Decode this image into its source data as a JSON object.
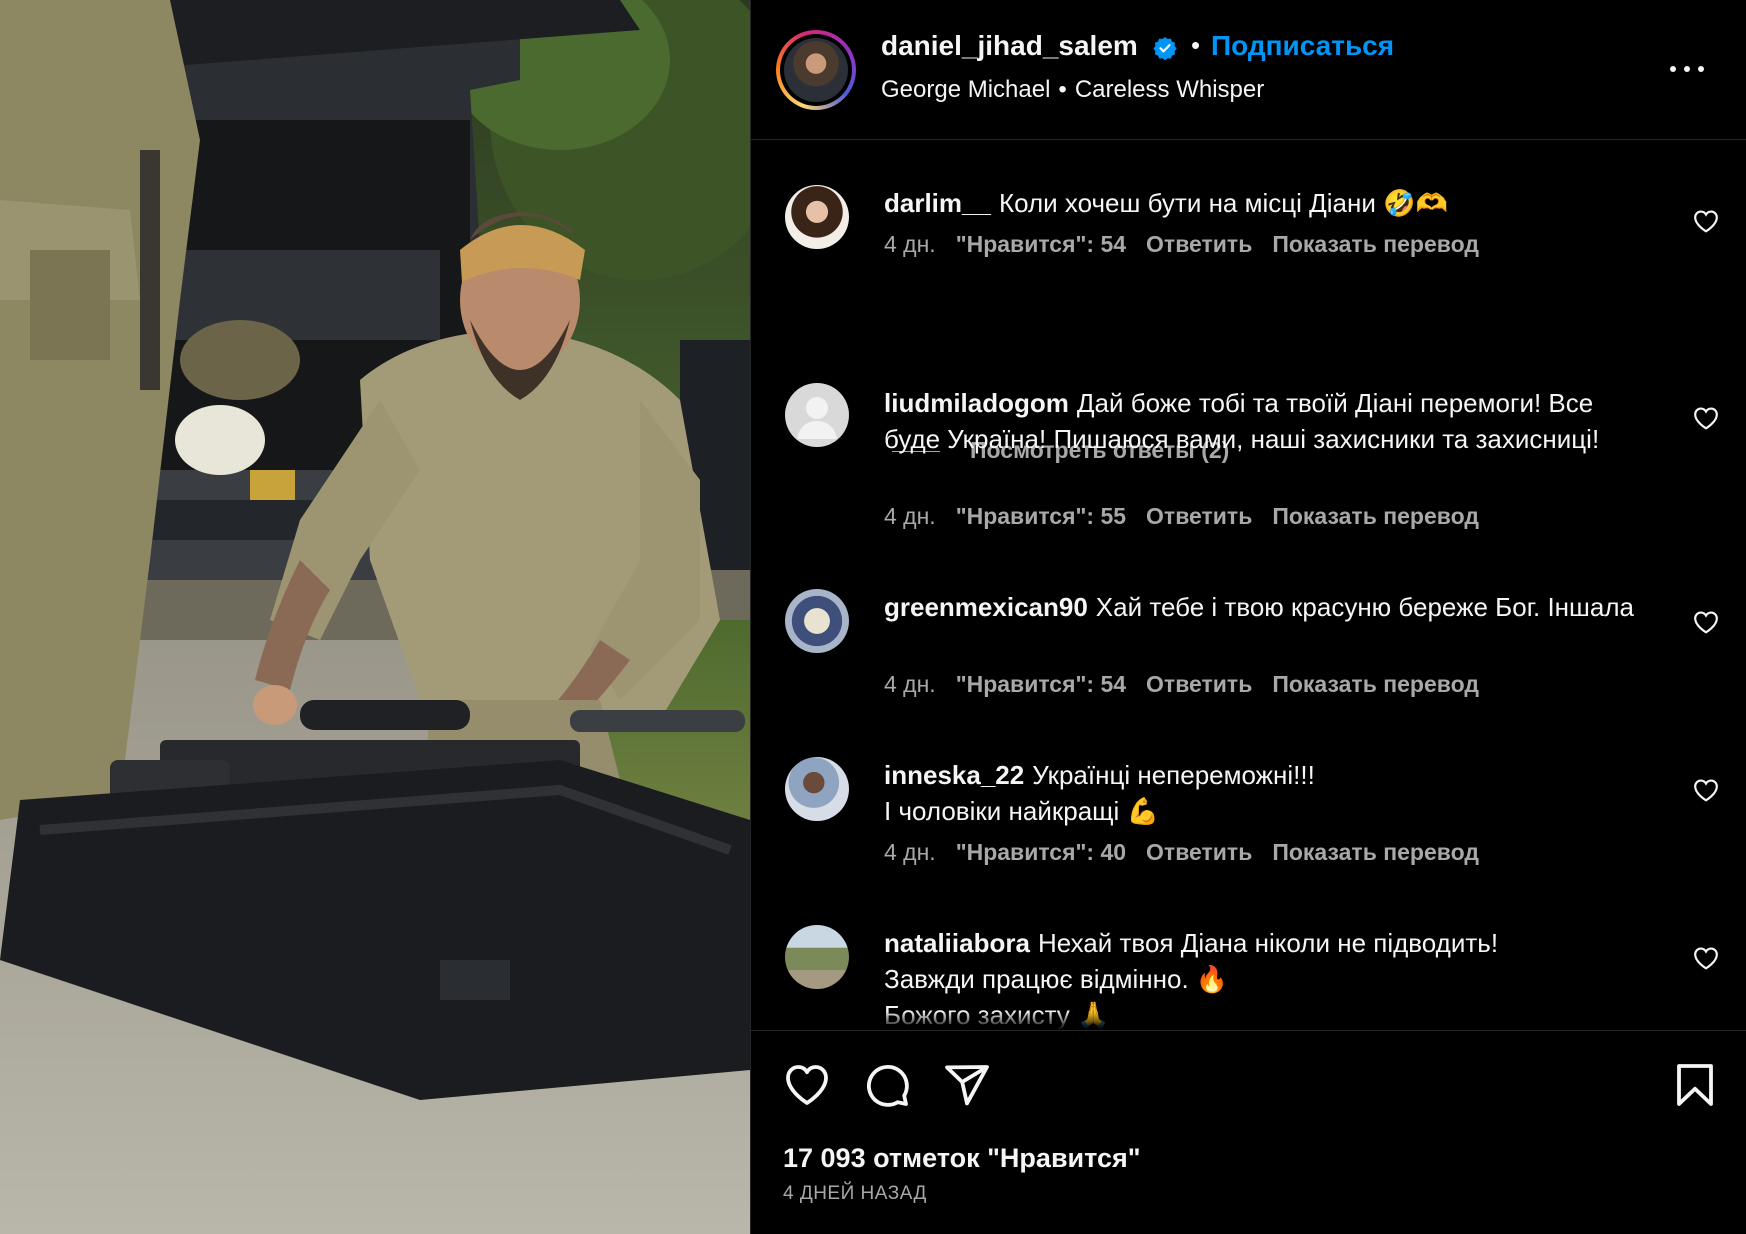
{
  "post": {
    "username": "daniel_jihad_salem",
    "verified": true,
    "separator": "•",
    "follow_label": "Подписаться",
    "music": {
      "artist": "George Michael",
      "separator": "•",
      "title": "Careless Whisper"
    }
  },
  "comments": [
    {
      "username": "darlim__",
      "text": "Коли хочеш бути на місці Діани 🤣🫶",
      "age": "4 дн.",
      "likes": "\"Нравится\": 54",
      "reply": "Ответить",
      "translate": "Показать перевод",
      "view_replies": "Посмотреть ответы (2)"
    },
    {
      "username": "liudmiladogom",
      "text": "Дай боже тобі та твоїй Діані перемоги! Все буде Україна! Пишаюся вами, наші захисники та захисниці!",
      "age": "4 дн.",
      "likes": "\"Нравится\": 55",
      "reply": "Ответить",
      "translate": "Показать перевод"
    },
    {
      "username": "greenmexican90",
      "text": "Хай тебе і твою красуню береже Бог. Іншала",
      "age": "4 дн.",
      "likes": "\"Нравится\": 54",
      "reply": "Ответить",
      "translate": "Показать перевод"
    },
    {
      "username": "inneska_22",
      "text": "Українці непереможні!!!",
      "text2": "І чоловіки найкращі 💪",
      "age": "4 дн.",
      "likes": "\"Нравится\": 40",
      "reply": "Ответить",
      "translate": "Показать перевод"
    },
    {
      "username": "nataliiabora",
      "text": "Нехай твоя Діана ніколи не підводить!",
      "text2": "Завжди працює відмінно. 🔥",
      "text3": "Божого захисту 🙏"
    }
  ],
  "footer": {
    "likes_count": "17 093 отметок \"Нравится\"",
    "time_ago": "4 ДНЕЙ НАЗАД"
  },
  "icons": [
    "verified-badge-icon",
    "more-options-icon",
    "heart-icon",
    "comment-icon",
    "share-icon",
    "bookmark-icon"
  ],
  "colors": {
    "background": "#000000",
    "text": "#f5f5f5",
    "secondary_text": "#a8a8a8",
    "link": "#0095f6",
    "divider": "#262626"
  }
}
